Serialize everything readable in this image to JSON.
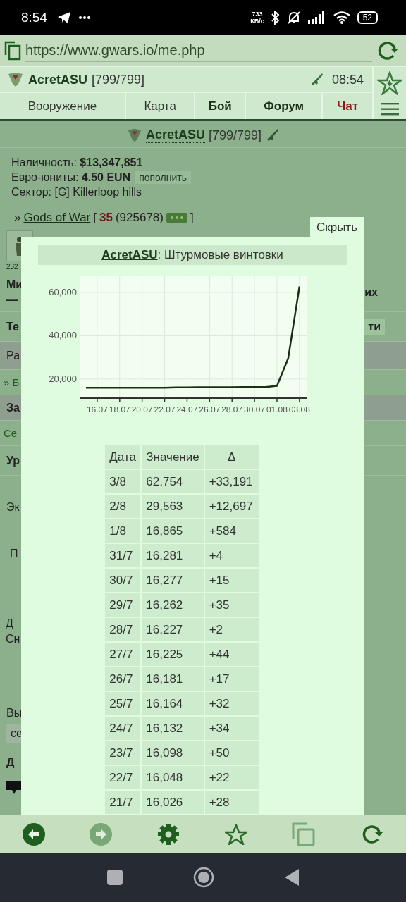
{
  "status_bar": {
    "time": "8:54",
    "speed": "733",
    "speed_unit": "КБ/с",
    "battery": "52"
  },
  "address_bar": {
    "url": "https://www.gwars.io/me.php"
  },
  "header": {
    "user": "AcretASU",
    "hp": "[799/799]",
    "clock": "08:54"
  },
  "tabs": [
    {
      "label": "Вооружение",
      "kind": "plain"
    },
    {
      "label": "Карта",
      "kind": "plain"
    },
    {
      "label": "Бой",
      "kind": "bold"
    },
    {
      "label": "Форум",
      "kind": "bold"
    },
    {
      "label": "Чат",
      "kind": "alert"
    }
  ],
  "profile": {
    "user": "AcretASU",
    "hp": "[799/799]",
    "cash_line": "Наличность: **$13,347,851**",
    "euro_line": "Евро-юниты: **4.50 EUN**",
    "topup": "пополнить",
    "sector": "Сектор: [G] Killerloop hills",
    "clan_prefix": "»",
    "clan": "Gods of War",
    "clan_open": "[",
    "clan_level": "35",
    "clan_points": "(925678)",
    "clan_close": "]"
  },
  "background_rows": [
    {
      "kind": "icons",
      "text": "232"
    },
    {
      "kind": "bold",
      "text": "Ми",
      "text2": "—",
      "right": "их"
    },
    {
      "kind": "bold",
      "text": "Те",
      "badge": "ти"
    },
    {
      "kind": "shaded",
      "text": "Ра"
    },
    {
      "kind": "link",
      "text": "» Б"
    },
    {
      "kind": "shaded-bold",
      "text": "За"
    },
    {
      "kind": "link",
      "text": "Се"
    },
    {
      "kind": "bold",
      "text": "Ур"
    },
    {
      "kind": "tall",
      "text": "Эк"
    },
    {
      "kind": "indent",
      "text": "П"
    },
    {
      "kind": "indent2",
      "text": "Д",
      "text2": "Сн"
    },
    {
      "kind": "low",
      "text": "Вы"
    },
    {
      "kind": "chip",
      "text": "се"
    },
    {
      "kind": "bold",
      "text": "Д"
    },
    {
      "kind": "device"
    }
  ],
  "popup": {
    "hide": "Скрыть",
    "user": "AcretASU",
    "title": ": Штурмовые винтовки",
    "chart_data": {
      "type": "line",
      "grid": true,
      "x": [
        null,
        "16.07",
        null,
        "18.07",
        null,
        "20.07",
        null,
        "22.07",
        null,
        "24.07",
        null,
        "26.07",
        null,
        "28.07",
        null,
        "30.07",
        null,
        "01.08",
        null,
        "03.08"
      ],
      "series": [
        {
          "color": "#1a2e1a",
          "values": [
            16000,
            16000,
            16000,
            16000,
            16000,
            16000,
            16000,
            16000,
            16100,
            16100,
            16200,
            16200,
            16200,
            16200,
            16300,
            16300,
            16300,
            16900,
            29600,
            62800
          ]
        }
      ],
      "ylim": [
        11500,
        67500
      ],
      "yticks": [
        {
          "value": 20000,
          "label": "20,000"
        },
        {
          "value": 40000,
          "label": "40,000"
        },
        {
          "value": 60000,
          "label": "60,000"
        }
      ]
    },
    "table": {
      "columns": [
        "Дата",
        "Значение",
        "Δ"
      ],
      "rows": [
        [
          "3/8",
          "62,754",
          "+33,191"
        ],
        [
          "2/8",
          "29,563",
          "+12,697"
        ],
        [
          "1/8",
          "16,865",
          "+584"
        ],
        [
          "31/7",
          "16,281",
          "+4"
        ],
        [
          "30/7",
          "16,277",
          "+15"
        ],
        [
          "29/7",
          "16,262",
          "+35"
        ],
        [
          "28/7",
          "16,227",
          "+2"
        ],
        [
          "27/7",
          "16,225",
          "+44"
        ],
        [
          "26/7",
          "16,181",
          "+17"
        ],
        [
          "25/7",
          "16,164",
          "+32"
        ],
        [
          "24/7",
          "16,132",
          "+34"
        ],
        [
          "23/7",
          "16,098",
          "+50"
        ],
        [
          "22/7",
          "16,048",
          "+22"
        ],
        [
          "21/7",
          "16,026",
          "+28"
        ]
      ]
    }
  }
}
